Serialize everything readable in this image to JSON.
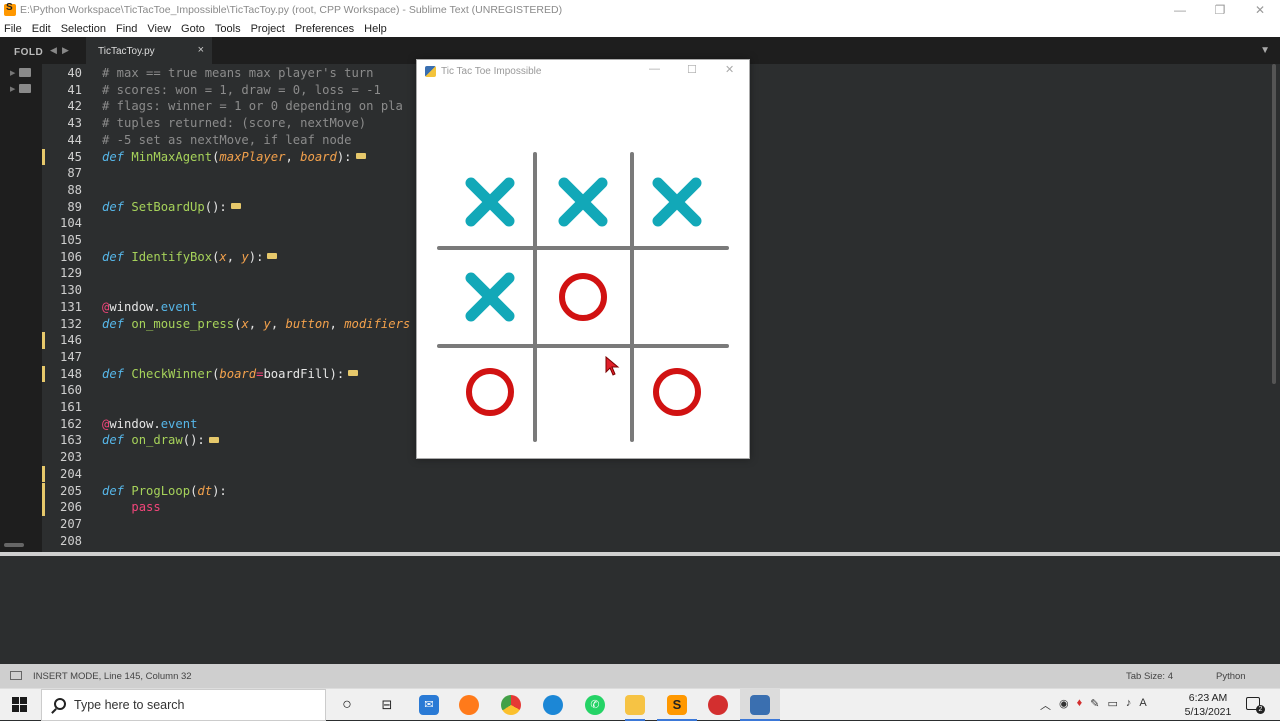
{
  "window": {
    "title": "E:\\Python Workspace\\TicTacToe_Impossible\\TicTacToy.py (root, CPP Workspace) - Sublime Text (UNREGISTERED)",
    "controls": [
      "—",
      "❐",
      "✕"
    ]
  },
  "menu": [
    "File",
    "Edit",
    "Selection",
    "Find",
    "View",
    "Goto",
    "Tools",
    "Project",
    "Preferences",
    "Help"
  ],
  "sidebar": {
    "label": "FOLD"
  },
  "tab": {
    "label": "TicTacToy.py",
    "close": "×"
  },
  "editor": {
    "lines": [
      {
        "num": "40",
        "tokens": [
          [
            "c-comment",
            "# max == true means max player's turn"
          ]
        ],
        "mark": false
      },
      {
        "num": "41",
        "tokens": [
          [
            "c-comment",
            "# scores: won = 1, draw = 0, loss = -1"
          ]
        ],
        "mark": false
      },
      {
        "num": "42",
        "tokens": [
          [
            "c-comment",
            "# flags: winner = 1 or 0 depending on pla"
          ]
        ],
        "mark": false
      },
      {
        "num": "43",
        "tokens": [
          [
            "c-comment",
            "# tuples returned: (score, nextMove)"
          ]
        ],
        "mark": false
      },
      {
        "num": "44",
        "tokens": [
          [
            "c-comment",
            "# -5 set as nextMove, if leaf node"
          ]
        ],
        "mark": false
      },
      {
        "num": "45",
        "tokens": [
          [
            "c-kw",
            "def "
          ],
          [
            "c-fn",
            "MinMaxAgent"
          ],
          [
            "c-plain",
            "("
          ],
          [
            "c-param",
            "maxPlayer"
          ],
          [
            "c-plain",
            ", "
          ],
          [
            "c-param",
            "board"
          ],
          [
            "c-plain",
            "):"
          ]
        ],
        "fold": true,
        "mark": true
      },
      {
        "num": "87",
        "tokens": [],
        "mark": false
      },
      {
        "num": "88",
        "tokens": [],
        "mark": false
      },
      {
        "num": "89",
        "tokens": [
          [
            "c-kw",
            "def "
          ],
          [
            "c-fn",
            "SetBoardUp"
          ],
          [
            "c-plain",
            "():"
          ]
        ],
        "fold": true,
        "mark": false
      },
      {
        "num": "104",
        "tokens": [],
        "mark": false
      },
      {
        "num": "105",
        "tokens": [],
        "mark": false
      },
      {
        "num": "106",
        "tokens": [
          [
            "c-kw",
            "def "
          ],
          [
            "c-fn",
            "IdentifyBox"
          ],
          [
            "c-plain",
            "("
          ],
          [
            "c-param",
            "x"
          ],
          [
            "c-plain",
            ", "
          ],
          [
            "c-param",
            "y"
          ],
          [
            "c-plain",
            "):"
          ]
        ],
        "fold": true,
        "mark": false
      },
      {
        "num": "129",
        "tokens": [],
        "mark": false
      },
      {
        "num": "130",
        "tokens": [],
        "mark": false
      },
      {
        "num": "131",
        "tokens": [
          [
            "c-deco-at",
            "@"
          ],
          [
            "c-deco",
            "window"
          ],
          [
            "c-plain",
            "."
          ],
          [
            "c-attr",
            "event"
          ]
        ],
        "mark": false
      },
      {
        "num": "132",
        "tokens": [
          [
            "c-kw",
            "def "
          ],
          [
            "c-fn",
            "on_mouse_press"
          ],
          [
            "c-plain",
            "("
          ],
          [
            "c-param",
            "x"
          ],
          [
            "c-plain",
            ", "
          ],
          [
            "c-param",
            "y"
          ],
          [
            "c-plain",
            ", "
          ],
          [
            "c-param",
            "button"
          ],
          [
            "c-plain",
            ", "
          ],
          [
            "c-param",
            "modifiers"
          ]
        ],
        "mark": false
      },
      {
        "num": "146",
        "tokens": [],
        "mark": true
      },
      {
        "num": "147",
        "tokens": [],
        "mark": false
      },
      {
        "num": "148",
        "tokens": [
          [
            "c-kw",
            "def "
          ],
          [
            "c-fn",
            "CheckWinner"
          ],
          [
            "c-plain",
            "("
          ],
          [
            "c-param",
            "board"
          ],
          [
            "c-op",
            "="
          ],
          [
            "c-plain",
            "boardFill):"
          ]
        ],
        "fold": true,
        "mark": true
      },
      {
        "num": "160",
        "tokens": [],
        "mark": false
      },
      {
        "num": "161",
        "tokens": [],
        "mark": false
      },
      {
        "num": "162",
        "tokens": [
          [
            "c-deco-at",
            "@"
          ],
          [
            "c-deco",
            "window"
          ],
          [
            "c-plain",
            "."
          ],
          [
            "c-attr",
            "event"
          ]
        ],
        "mark": false
      },
      {
        "num": "163",
        "tokens": [
          [
            "c-kw",
            "def "
          ],
          [
            "c-fn",
            "on_draw"
          ],
          [
            "c-plain",
            "():"
          ]
        ],
        "fold": true,
        "mark": false
      },
      {
        "num": "203",
        "tokens": [],
        "mark": false
      },
      {
        "num": "204",
        "tokens": [],
        "mark": true
      },
      {
        "num": "205",
        "tokens": [
          [
            "c-kw",
            "def "
          ],
          [
            "c-fn",
            "ProgLoop"
          ],
          [
            "c-plain",
            "("
          ],
          [
            "c-param",
            "dt"
          ],
          [
            "c-plain",
            "):"
          ]
        ],
        "mark": true
      },
      {
        "num": "206",
        "tokens": [
          [
            "c-plain",
            "    "
          ],
          [
            "c-pass",
            "pass"
          ]
        ],
        "mark": true
      },
      {
        "num": "207",
        "tokens": [],
        "mark": false
      },
      {
        "num": "208",
        "tokens": [],
        "mark": false
      }
    ]
  },
  "status": {
    "text": "INSERT MODE, Line 145, Column 32",
    "tab_size": "Tab Size: 4",
    "syntax": "Python"
  },
  "taskbar": {
    "search_placeholder": "Type here to search",
    "time": "6:23 AM",
    "date": "5/13/2021",
    "notification_count": "2"
  },
  "game": {
    "title": "Tic Tac Toe Impossible",
    "board": [
      [
        "X",
        "X",
        "X"
      ],
      [
        "X",
        "O",
        ""
      ],
      [
        "O",
        "",
        "O"
      ]
    ],
    "colors": {
      "x": "#12a8b8",
      "o": "#d11212",
      "grid": "#7a7a7a"
    }
  }
}
